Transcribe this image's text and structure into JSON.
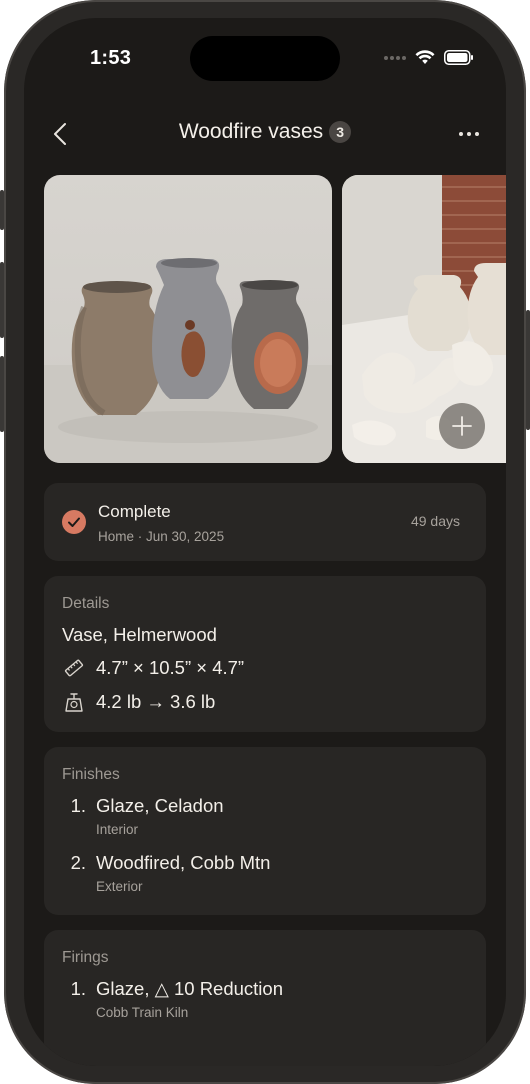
{
  "status_bar": {
    "time": "1:53"
  },
  "nav": {
    "title": "Woodfire vases",
    "count": "3"
  },
  "photos": [
    {
      "icon": "vases-photo",
      "description_icon": "ceramic-vases"
    },
    {
      "icon": "bisque-pieces-photo"
    }
  ],
  "status": {
    "label": "Complete",
    "subtitle": "Home · Jun 30, 2025",
    "days": "49 days",
    "accent": "#d77a62"
  },
  "details": {
    "title": "Details",
    "name": "Vase, Helmerwood",
    "dimensions": "4.7” × 10.5” × 4.7”",
    "weight": "4.2 lb → 3.6 lb"
  },
  "finishes": {
    "title": "Finishes",
    "items": [
      {
        "num": "1.",
        "name": "Glaze, Celadon",
        "sub": "Interior"
      },
      {
        "num": "2.",
        "name": "Woodfired, Cobb Mtn",
        "sub": "Exterior"
      }
    ]
  },
  "firings": {
    "title": "Firings",
    "items": [
      {
        "num": "1.",
        "name": "Glaze, △ 10 Reduction",
        "sub": "Cobb Train Kiln"
      }
    ]
  }
}
